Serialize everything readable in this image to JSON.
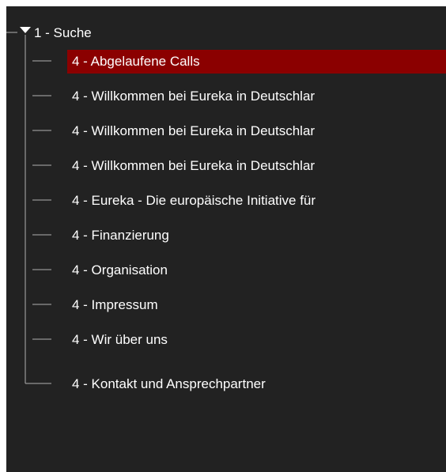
{
  "tree": {
    "root": {
      "label": "1 - Suche",
      "expanded": true
    },
    "selected_index": 0,
    "items": [
      {
        "label": "4 - Abgelaufene Calls"
      },
      {
        "label": "4 - Willkommen bei Eureka in Deutschlar"
      },
      {
        "label": "4 - Willkommen bei Eureka in Deutschlar"
      },
      {
        "label": "4 - Willkommen bei Eureka in Deutschlar"
      },
      {
        "label": "4 - Eureka - Die europäische Initiative für"
      },
      {
        "label": "4 - Finanzierung"
      },
      {
        "label": "4 - Organisation"
      },
      {
        "label": "4 - Impressum"
      },
      {
        "label": "4 - Wir über uns"
      },
      {
        "label": "4 - Kontakt und Ansprechpartner"
      }
    ]
  },
  "colors": {
    "panel_background": "#222222",
    "selected_background": "#8b0000",
    "text": "#ffffff",
    "tree_line": "#b0b0b0"
  }
}
